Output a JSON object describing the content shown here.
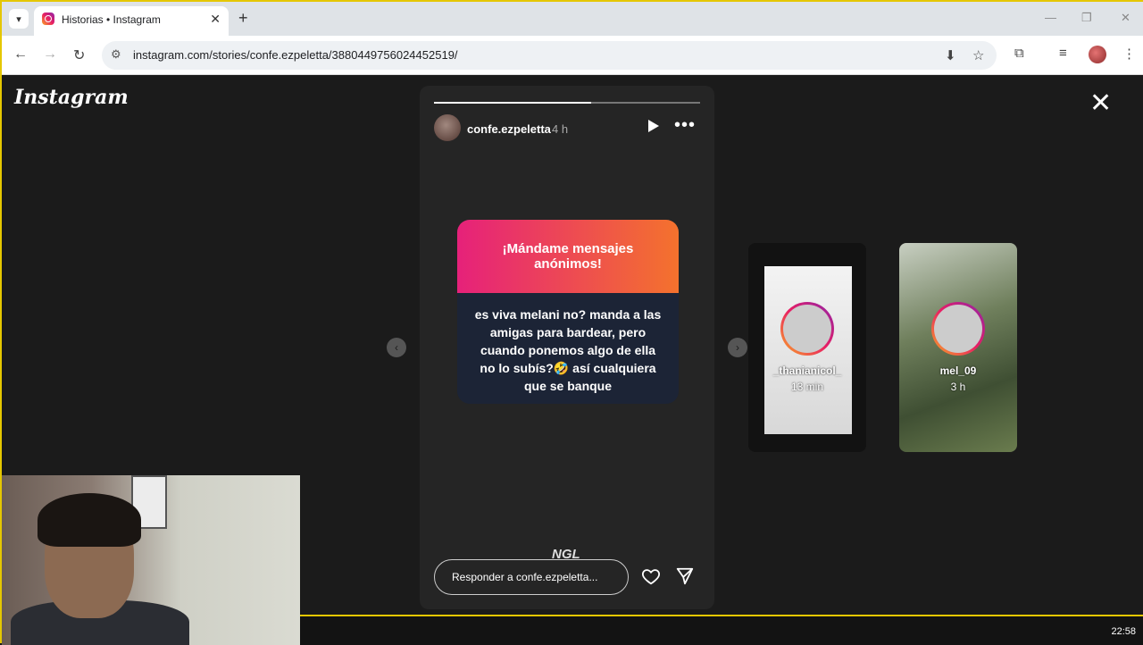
{
  "browser": {
    "tab_title": "Historias • Instagram",
    "url": "instagram.com/stories/confe.ezpeletta/3880449756024452519/"
  },
  "page": {
    "logo": "Instagram"
  },
  "story": {
    "username": "confe.ezpeletta",
    "time": "4 h",
    "progress": 0.59,
    "card_header": "¡Mándame mensajes anónimos!",
    "card_body": "es viva melani no? manda a las amigas para bardear, pero cuando ponemos algo de ella no lo subís?🤣 así cualquiera que se banque",
    "sticker": "NGL",
    "reply_placeholder": "Responder a confe.ezpeletta..."
  },
  "previews": [
    {
      "username": "_thanianicol_",
      "time": "13 min"
    },
    {
      "username": "mel_09",
      "time": "3 h"
    }
  ],
  "taskbar": {
    "clock": "22:58"
  },
  "colors": {
    "accent": "#e5c700",
    "card_gradient_start": "#e6217a",
    "card_gradient_end": "#f4722d"
  }
}
